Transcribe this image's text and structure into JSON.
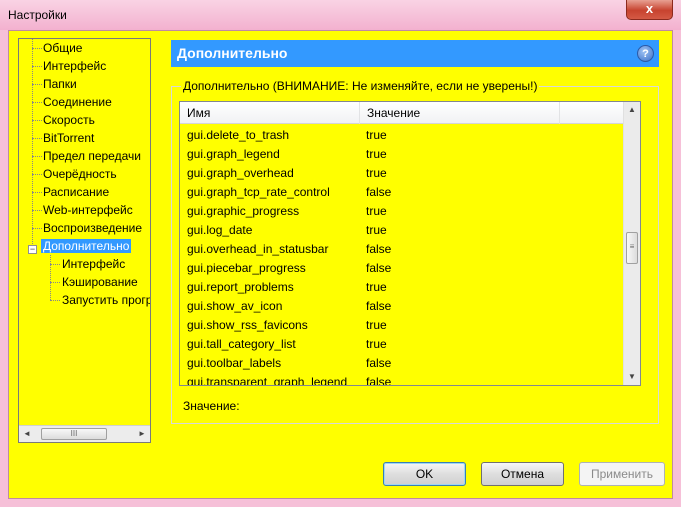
{
  "window": {
    "title": "Настройки",
    "close_glyph": "x"
  },
  "sidebar": {
    "items": [
      {
        "label": "Общие"
      },
      {
        "label": "Интерфейс"
      },
      {
        "label": "Папки"
      },
      {
        "label": "Соединение"
      },
      {
        "label": "Скорость"
      },
      {
        "label": "BitTorrent"
      },
      {
        "label": "Предел передачи"
      },
      {
        "label": "Очерёдность"
      },
      {
        "label": "Расписание"
      },
      {
        "label": "Web-интерфейс"
      },
      {
        "label": "Воспроизведение"
      },
      {
        "label": "Дополнительно",
        "selected": true
      },
      {
        "label": "Интерфейс",
        "child": true
      },
      {
        "label": "Кэширование",
        "child": true
      },
      {
        "label": "Запустить прогр",
        "child": true
      }
    ],
    "expander_glyph": "−"
  },
  "panel": {
    "title": "Дополнительно",
    "help_glyph": "?",
    "group_caption": "Дополнительно (ВНИМАНИЕ: Не изменяйте, если не уверены!)",
    "columns": {
      "name": "Имя",
      "value": "Значение"
    },
    "rows": [
      {
        "name": "gui.delete_to_trash",
        "value": "true"
      },
      {
        "name": "gui.graph_legend",
        "value": "true"
      },
      {
        "name": "gui.graph_overhead",
        "value": "true"
      },
      {
        "name": "gui.graph_tcp_rate_control",
        "value": "false"
      },
      {
        "name": "gui.graphic_progress",
        "value": "true"
      },
      {
        "name": "gui.log_date",
        "value": "true"
      },
      {
        "name": "gui.overhead_in_statusbar",
        "value": "false"
      },
      {
        "name": "gui.piecebar_progress",
        "value": "false"
      },
      {
        "name": "gui.report_problems",
        "value": "true"
      },
      {
        "name": "gui.show_av_icon",
        "value": "false"
      },
      {
        "name": "gui.show_rss_favicons",
        "value": "true"
      },
      {
        "name": "gui.tall_category_list",
        "value": "true"
      },
      {
        "name": "gui.toolbar_labels",
        "value": "false"
      },
      {
        "name": "gui.transparent_graph_legend",
        "value": "false"
      }
    ],
    "value_label": "Значение:"
  },
  "buttons": {
    "ok": "OK",
    "cancel": "Отмена",
    "apply": "Применить"
  },
  "scroll_glyphs": {
    "up": "▲",
    "down": "▼",
    "left": "◄",
    "right": "►",
    "grip_h": "III",
    "grip_v": "≡"
  },
  "colors": {
    "background": "#ffff00",
    "header": "#3399ff",
    "selection": "#3399ff"
  }
}
